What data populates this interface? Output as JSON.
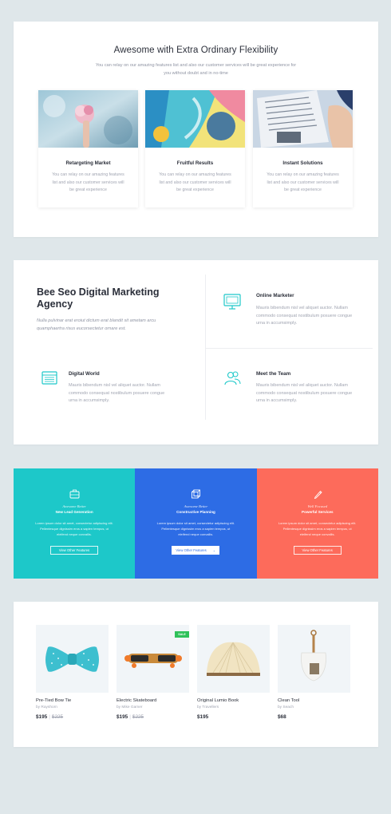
{
  "section1": {
    "title": "Awesome with Extra Ordinary Flexibility",
    "subtitle": "You can relay on our amazing features list and also our customer services will be great experience for you without doubt and in no-time",
    "features": [
      {
        "title": "Retargeting Market",
        "text": "You can relay on our amazing features list and also our customer services will be great experience"
      },
      {
        "title": "Fruitful Results",
        "text": "You can relay on our amazing features list and also our customer services will be great experience"
      },
      {
        "title": "Instant Solutions",
        "text": "You can relay on our amazing features list and also our customer services will be great experience"
      }
    ]
  },
  "section2": {
    "title": "Bee Seo Digital Marketing Agency",
    "text": "Nulla pulvinar erat eroiut dictum erat blandit sit ametam arcu quamphaertra risus eucorsectetur ornare est.",
    "services": [
      {
        "title": "Online Marketer",
        "icon": "monitor-icon",
        "text": "Mauris bibendum nisl vel aliquet auctor. Nullam commodo consequat nostibulum posuere congue urna in accumsimply."
      },
      {
        "title": "Digital World",
        "icon": "browser-icon",
        "text": "Mauris bibendum nisl vel aliquet auctor. Nullam commodo consequat nostibulum posuere congue urna in accumsimply."
      },
      {
        "title": "Meet the Team",
        "icon": "team-icon",
        "text": "Mauris bibendum nisl vel aliquet auctor. Nullam commodo consequat nostibulum posuere congue urna in accumsimply."
      }
    ]
  },
  "section3": {
    "panels": [
      {
        "kicker": "Awesome Better",
        "title": "New Lead Generation",
        "text": "Lorem ipsum dolor sit amet, consectetur adipiscing elit. Pellentesque dignissim eros a sapien tempus, ut eleifend neque convallis.",
        "button": "View Other Features",
        "color": "#1dc8c9",
        "icon": "briefcase-icon"
      },
      {
        "kicker": "Awesome Better",
        "title": "Constructive Planning",
        "text": "Lorem ipsum dolor sit amet, consectetur adipiscing elit. Pellentesque dignissim eros a sapien tempus, ut eleifend neque convallis.",
        "button": "View Other Features",
        "color": "#2d6ce5",
        "icon": "cube-icon"
      },
      {
        "kicker": "Well Focused",
        "title": "Powerful Services",
        "text": "Lorem ipsum dolor sit amet, consectetur adipiscing elit. Pellentesque dignissim eros a sapien tempus, ut eleifend neque convallis.",
        "button": "View Other Features",
        "color": "#fd6b5b",
        "icon": "pencil-icon"
      }
    ]
  },
  "section4": {
    "products": [
      {
        "name": "Pre-Tied Bow Tie",
        "by": "by Rayshorn",
        "price": "$195",
        "old_price": "$225",
        "sale": ""
      },
      {
        "name": "Electric Skateboard",
        "by": "by Mike Gamer",
        "price": "$195",
        "old_price": "$225",
        "sale": "SALE"
      },
      {
        "name": "Original Lumio Book",
        "by": "by Travellers",
        "price": "$195",
        "old_price": "",
        "sale": ""
      },
      {
        "name": "Clean Tool",
        "by": "by Seach",
        "price": "$68",
        "old_price": "",
        "sale": ""
      }
    ]
  }
}
